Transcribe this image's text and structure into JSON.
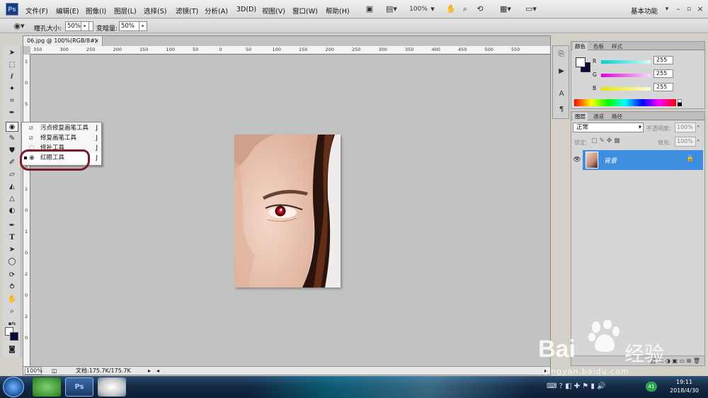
{
  "app": {
    "logo": "Ps",
    "workspace": "基本功能",
    "zoom": "100%"
  },
  "menu": [
    "文件(F)",
    "编辑(E)",
    "图像(I)",
    "图层(L)",
    "选择(S)",
    "滤镜(T)",
    "分析(A)",
    "3D(D)",
    "视图(V)",
    "窗口(W)",
    "帮助(H)"
  ],
  "options": {
    "pupil_label": "瞳孔大小:",
    "pupil_value": "50%",
    "darken_label": "变暗量:",
    "darken_value": "50%"
  },
  "document": {
    "tab_title": "06.jpg @ 100%(RGB/8#)",
    "zoom": "100%",
    "doc_info": "文档:175.7K/175.7K"
  },
  "hruler_ticks": [
    "350",
    "300",
    "250",
    "200",
    "150",
    "100",
    "50",
    "0",
    "50",
    "100",
    "150",
    "200",
    "250",
    "300",
    "350",
    "400",
    "450",
    "500",
    "550"
  ],
  "vruler_ticks": [
    "1",
    "0",
    "5",
    "0",
    "1",
    "0",
    "1",
    "0",
    "1",
    "0",
    "2",
    "0",
    "2",
    "0"
  ],
  "flyout": [
    {
      "label": "污点修复画笔工具",
      "key": "J",
      "icon": "bandage-icon"
    },
    {
      "label": "修复画笔工具",
      "key": "J",
      "icon": "bandage-icon"
    },
    {
      "label": "修补工具",
      "key": "J",
      "icon": "patch-icon"
    },
    {
      "label": "红眼工具",
      "key": "J",
      "icon": "red-eye-icon"
    }
  ],
  "color_panel": {
    "tabs": [
      "颜色",
      "色板",
      "样式"
    ],
    "channels": [
      {
        "name": "R",
        "value": "255",
        "color": "#00d7d7"
      },
      {
        "name": "G",
        "value": "255",
        "color": "#e000e0"
      },
      {
        "name": "B",
        "value": "255",
        "color": "#e6e600"
      }
    ]
  },
  "layers_panel": {
    "tabs": [
      "图层",
      "通道",
      "路径"
    ],
    "blend_mode": "正常",
    "opacity_label": "不透明度:",
    "opacity": "100%",
    "lock_label": "锁定:",
    "fill_label": "填充:",
    "fill": "100%",
    "layer_name": "背景"
  },
  "taskbar": {
    "time": "19:11",
    "date": "2018/4/30",
    "badge": "41"
  },
  "watermark": {
    "brand": "Bai",
    "brand_cn": "经验",
    "url": "jingyan.baidu.com"
  }
}
